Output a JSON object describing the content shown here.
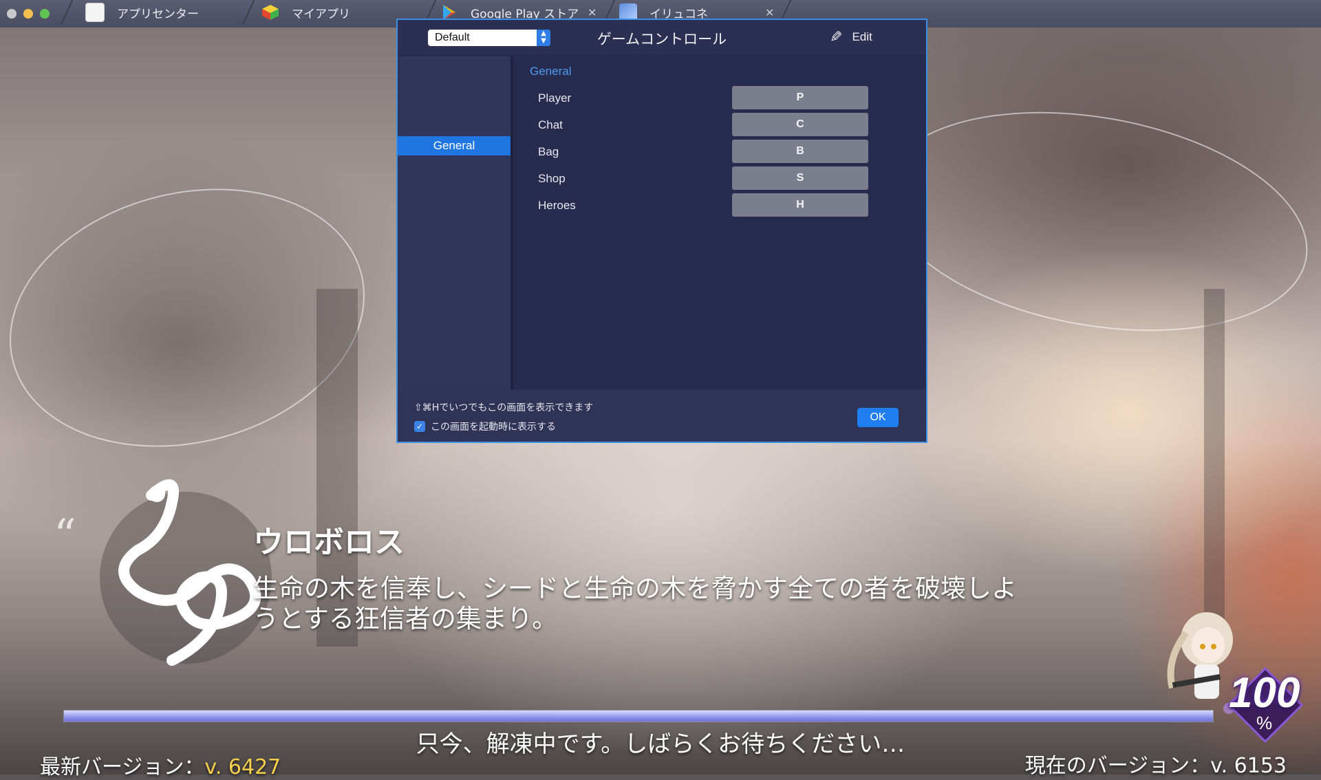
{
  "window": {
    "tabs": [
      {
        "label": "アプリセンター",
        "icon": "app-center-icon"
      },
      {
        "label": "マイアプリ",
        "icon": "my-apps-icon"
      },
      {
        "label": "Google Play ストア",
        "icon": "play-store-icon"
      },
      {
        "label": "イリュコネ",
        "icon": "game-icon"
      }
    ],
    "close_glyph": "×"
  },
  "dialog": {
    "title": "ゲームコントロール",
    "profile_select": {
      "value": "Default"
    },
    "edit_label": "Edit",
    "sidebar": {
      "items": [
        {
          "label": "General",
          "selected": true
        }
      ]
    },
    "section_title": "General",
    "controls": [
      {
        "label": "Player",
        "key": "P"
      },
      {
        "label": "Chat",
        "key": "C"
      },
      {
        "label": "Bag",
        "key": "B"
      },
      {
        "label": "Shop",
        "key": "S"
      },
      {
        "label": "Heroes",
        "key": "H"
      }
    ],
    "footer": {
      "hint": "⇧⌘Hでいつでもこの画面を表示できます",
      "checkbox_label": "この画面を起動時に表示する",
      "checkbox_checked": true,
      "ok_label": "OK"
    },
    "accent_color": "#2076e0"
  },
  "game": {
    "quote_mark": "“",
    "faction_name": "ウロボロス",
    "description": "生命の木を信奉し、シードと生命の木を脅かす全ての者を破壊しようとする狂信者の集まり。",
    "loading_status": "只今、解凍中です。しばらくお待ちください…",
    "progress_percent": 100,
    "percent_value": "100",
    "percent_sign": "%",
    "latest_version_label": "最新バージョン：",
    "latest_version_value": "v. 6427",
    "current_version": "現在のバージョン：v. 6153"
  }
}
